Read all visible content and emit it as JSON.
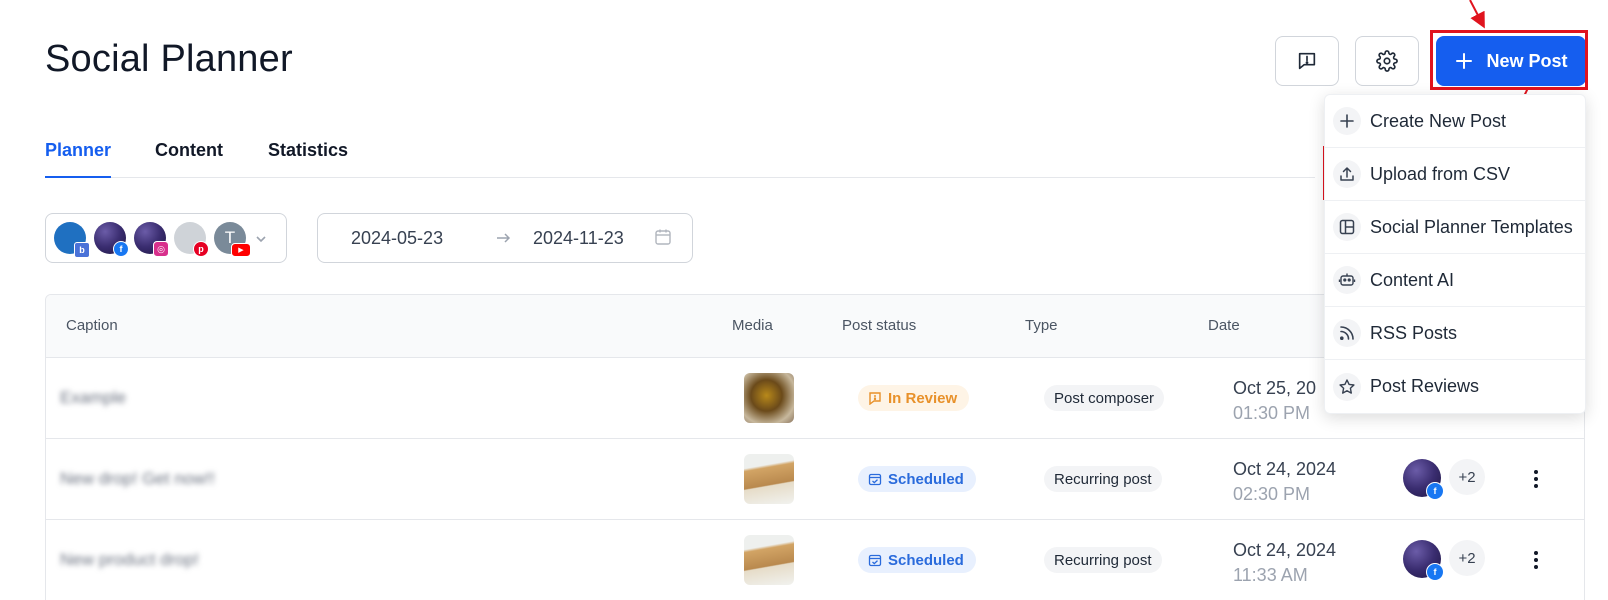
{
  "header": {
    "title": "Social Planner",
    "new_post_label": "New Post"
  },
  "tabs": [
    {
      "label": "Planner",
      "active": true
    },
    {
      "label": "Content",
      "active": false
    },
    {
      "label": "Statistics",
      "active": false
    }
  ],
  "filters": {
    "start_date": "2024-05-23",
    "end_date": "2024-11-23",
    "account_avatar_letter": "T"
  },
  "table": {
    "columns": [
      "Caption",
      "Media",
      "Post status",
      "Type",
      "Date"
    ],
    "rows": [
      {
        "caption": "Example",
        "status": "In Review",
        "type": "Post composer",
        "date": "Oct 25, 20",
        "time": "01:30 PM",
        "extra": ""
      },
      {
        "caption": "New drop! Get now!!",
        "status": "Scheduled",
        "type": "Recurring post",
        "date": "Oct 24, 2024",
        "time": "02:30 PM",
        "extra": "+2"
      },
      {
        "caption": "New product drop!",
        "status": "Scheduled",
        "type": "Recurring post",
        "date": "Oct 24, 2024",
        "time": "11:33 AM",
        "extra": "+2"
      }
    ]
  },
  "dropdown": {
    "items": [
      {
        "label": "Create New Post",
        "icon": "plus-icon"
      },
      {
        "label": "Upload from CSV",
        "icon": "upload-icon"
      },
      {
        "label": "Social Planner Templates",
        "icon": "template-icon"
      },
      {
        "label": "Content AI",
        "icon": "robot-icon"
      },
      {
        "label": "RSS Posts",
        "icon": "rss-icon"
      },
      {
        "label": "Post Reviews",
        "icon": "star-icon"
      }
    ]
  },
  "colors": {
    "primary": "#155eef",
    "highlight": "#e0141e",
    "review": "#e8912a",
    "scheduled": "#2a6bdc"
  }
}
